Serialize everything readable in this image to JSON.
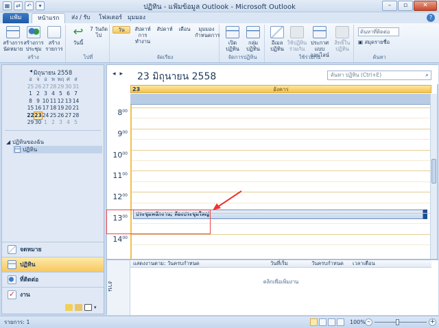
{
  "window": {
    "title": "ปฏิทิน - แฟ้มข้อมูล Outlook - Microsoft Outlook"
  },
  "tabs": {
    "file": "แฟ้ม",
    "home": "หน้าแรก",
    "send_receive": "ส่ง / รับ",
    "folder": "โฟลเดอร์",
    "view": "มุมมอง"
  },
  "ribbon": {
    "new_appointment": "สร้างการนัดหมาย",
    "new_meeting": "สร้างการประชุม",
    "new_items": "สร้างรายการ",
    "group_new": "สร้าง",
    "today": "วันนี้",
    "next7": "7 วันถัดไป",
    "group_goto": "ไปที่",
    "day": "วัน",
    "work_week": "สัปดาห์การทำงาน",
    "week": "สัปดาห์",
    "month": "เดือน",
    "schedule_view": "มุมมองกำหนดการ",
    "group_arrange": "จัดเรียง",
    "open_calendar": "เปิดปฏิทิน",
    "calendar_groups": "กลุ่มปฏิทิน",
    "group_manage": "จัดการปฏิทิน",
    "email_calendar": "อีเมลปฏิทิน",
    "share_calendar": "ใช้ปฏิทินร่วมกัน",
    "publish_online": "ประกาศแบบออนไลน์",
    "calendar_permissions": "สิทธิ์ในปฏิทิน",
    "group_share": "ใช้ร่วมกัน",
    "search_people": "ค้นหาที่ติดต่อ",
    "address_book": "สมุดรายชื่อ",
    "group_find": "ค้นหา"
  },
  "minical": {
    "month_label": "มิถุนายน 2558",
    "weekdays": [
      "อ",
      "จ",
      "อ",
      "พ",
      "พฤ",
      "ศ",
      "ส"
    ],
    "weeks": [
      [
        "25",
        "26",
        "27",
        "28",
        "29",
        "30",
        "31"
      ],
      [
        "1",
        "2",
        "3",
        "4",
        "5",
        "6",
        "7"
      ],
      [
        "8",
        "9",
        "10",
        "11",
        "12",
        "13",
        "14"
      ],
      [
        "15",
        "16",
        "17",
        "18",
        "19",
        "20",
        "21"
      ],
      [
        "22",
        "23",
        "24",
        "25",
        "26",
        "27",
        "28"
      ],
      [
        "29",
        "30",
        "1",
        "2",
        "3",
        "4",
        "5"
      ]
    ],
    "today": "23"
  },
  "nav": {
    "my_calendars": "ปฏิทินของฉัน",
    "calendar_item": "ปฏิทิน",
    "mail": "จดหมาย",
    "calendar": "ปฏิทิน",
    "contacts": "ที่ติดต่อ",
    "tasks": "งาน"
  },
  "main": {
    "date_title": "23 มิถุนายน 2558",
    "search_placeholder": "ค้นหา ปฏิทิน (Ctrl+E)",
    "day_number": "23",
    "day_name": "อังคาร",
    "hours": [
      "8",
      "9",
      "10",
      "11",
      "12",
      "13",
      "14"
    ],
    "minutes": "00",
    "appointment": "ประชุมพนักงาน; ห้องประชุมใหญ่"
  },
  "tasks": {
    "side_label": "งาน",
    "header_arrange": "แสดงงานตาม: วันครบกำหนด",
    "header_start": "วันที่เริ่ม",
    "header_due": "วันครบกำหนด",
    "header_reminder": "เวลาเตือน",
    "empty_text": "คลิกเพื่อเพิ่มงาน"
  },
  "status": {
    "items": "รายการ: 1",
    "zoom": "100%"
  }
}
